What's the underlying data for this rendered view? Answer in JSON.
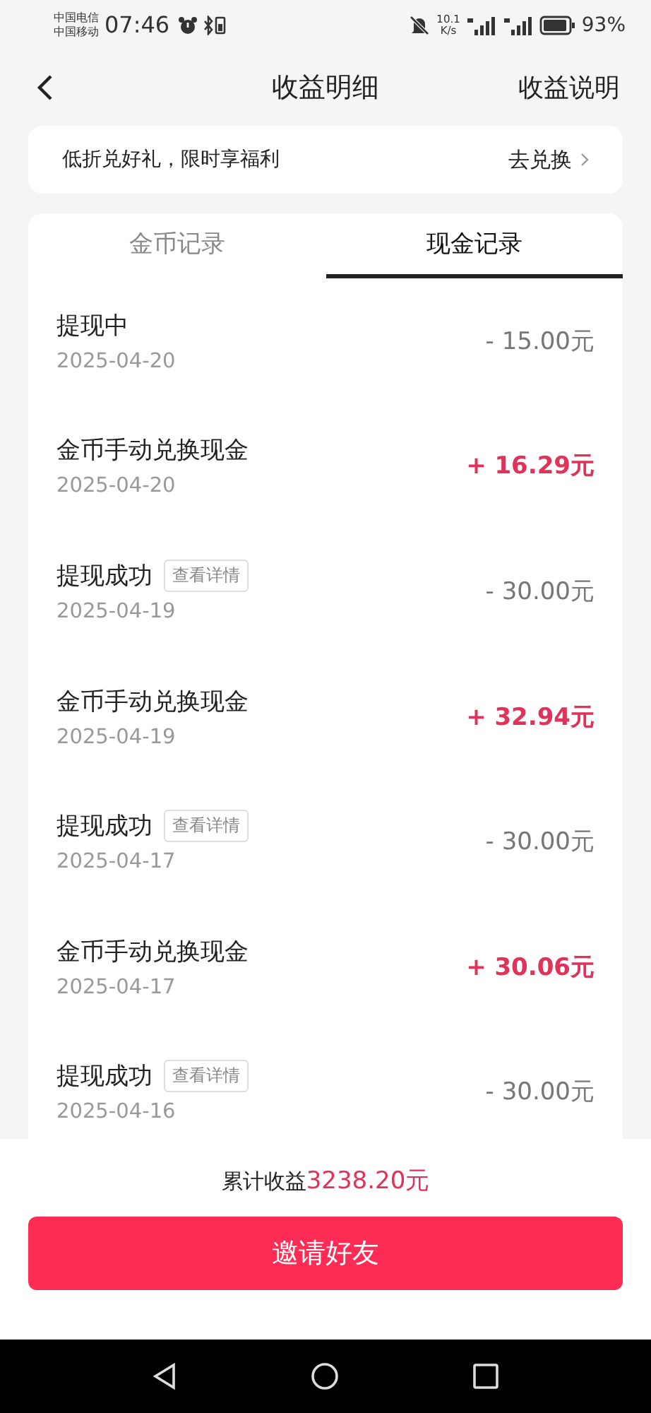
{
  "status_bar": {
    "carriers": [
      "中国电信",
      "中国移动"
    ],
    "time": "07:46",
    "speed": "10.1",
    "speed_unit": "K/s",
    "battery": "93%"
  },
  "header": {
    "title": "收益明细",
    "action": "收益说明"
  },
  "promo": {
    "text": "低折兑好礼，限时享福利",
    "action": "去兑换"
  },
  "tabs": [
    {
      "label": "金币记录",
      "selected": false
    },
    {
      "label": "现金记录",
      "selected": true
    }
  ],
  "records": [
    {
      "title": "提现中",
      "date": "2025-04-20",
      "amount": "- 15.00元",
      "kind": "debit"
    },
    {
      "title": "金币手动兑换现金",
      "date": "2025-04-20",
      "amount": "+ 16.29元",
      "kind": "credit"
    },
    {
      "title": "提现成功",
      "detail": "查看详情",
      "date": "2025-04-19",
      "amount": "- 30.00元",
      "kind": "debit"
    },
    {
      "title": "金币手动兑换现金",
      "date": "2025-04-19",
      "amount": "+ 32.94元",
      "kind": "credit"
    },
    {
      "title": "提现成功",
      "detail": "查看详情",
      "date": "2025-04-17",
      "amount": "- 30.00元",
      "kind": "debit"
    },
    {
      "title": "金币手动兑换现金",
      "date": "2025-04-17",
      "amount": "+ 30.06元",
      "kind": "credit"
    },
    {
      "title": "提现成功",
      "detail": "查看详情",
      "date": "2025-04-16",
      "amount": "- 30.00元",
      "kind": "debit"
    }
  ],
  "total": {
    "label": "累计收益",
    "value": "3238.20元"
  },
  "invite_button": "邀请好友"
}
